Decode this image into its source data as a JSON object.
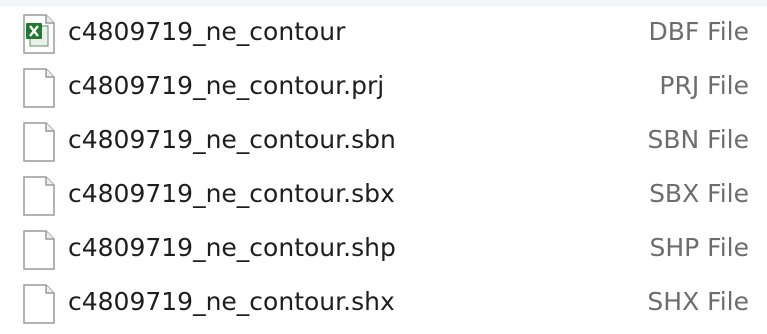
{
  "files": [
    {
      "name": "c4809719_ne_contour",
      "type": "DBF File",
      "icon": "excel-file-icon"
    },
    {
      "name": "c4809719_ne_contour.prj",
      "type": "PRJ File",
      "icon": "blank-file-icon"
    },
    {
      "name": "c4809719_ne_contour.sbn",
      "type": "SBN File",
      "icon": "blank-file-icon"
    },
    {
      "name": "c4809719_ne_contour.sbx",
      "type": "SBX File",
      "icon": "blank-file-icon"
    },
    {
      "name": "c4809719_ne_contour.shp",
      "type": "SHP File",
      "icon": "blank-file-icon"
    },
    {
      "name": "c4809719_ne_contour.shx",
      "type": "SHX File",
      "icon": "blank-file-icon"
    }
  ],
  "colors": {
    "excel_green": "#1f7a2e",
    "type_text": "#6d6d6d",
    "name_text": "#1e1e1e"
  }
}
